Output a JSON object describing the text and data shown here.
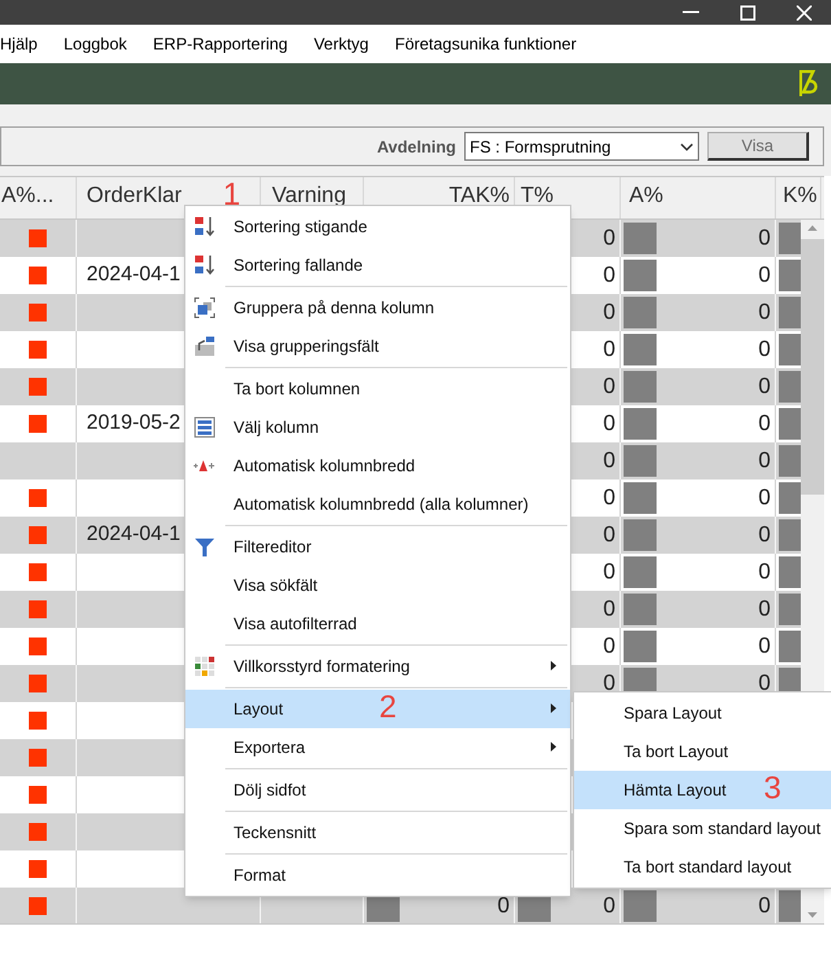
{
  "menu_bar": [
    "Hjälp",
    "Loggbok",
    "ERP-Rapportering",
    "Verktyg",
    "Företagsunika funktioner"
  ],
  "toolbar": {
    "label": "Avdelning",
    "department": {
      "value": "FS : Formsprutning"
    },
    "button": "Visa"
  },
  "grid": {
    "columns": [
      {
        "label": "A%..."
      },
      {
        "label": "OrderKlar",
        "annotation": "1"
      },
      {
        "label": "Varning"
      },
      {
        "label": "TAK%"
      },
      {
        "label": "T%"
      },
      {
        "label": "A%"
      },
      {
        "label": "K%"
      }
    ],
    "rows": [
      {
        "flag": true,
        "cells": [
          "",
          "",
          "",
          "",
          "0",
          "0",
          ""
        ],
        "bars": [
          false,
          false,
          true,
          true
        ]
      },
      {
        "flag": true,
        "cells": [
          "",
          "2024-04-1",
          "",
          "",
          "0",
          "0",
          ""
        ],
        "bars": [
          false,
          false,
          true,
          true
        ]
      },
      {
        "flag": true,
        "cells": [
          "",
          "",
          "",
          "",
          "0",
          "0",
          ""
        ],
        "bars": [
          false,
          false,
          true,
          true
        ]
      },
      {
        "flag": true,
        "cells": [
          "",
          "",
          "",
          "",
          "0",
          "0",
          ""
        ],
        "bars": [
          false,
          false,
          true,
          true
        ]
      },
      {
        "flag": true,
        "cells": [
          "",
          "",
          "",
          "",
          "0",
          "0",
          ""
        ],
        "bars": [
          false,
          false,
          true,
          true
        ]
      },
      {
        "flag": true,
        "cells": [
          "",
          "2019-05-2",
          "",
          "",
          "0",
          "0",
          ""
        ],
        "bars": [
          false,
          false,
          true,
          true
        ]
      },
      {
        "flag": false,
        "cells": [
          "",
          "",
          "",
          "",
          "0",
          "0",
          ""
        ],
        "bars": [
          false,
          false,
          true,
          true
        ]
      },
      {
        "flag": true,
        "cells": [
          "",
          "",
          "",
          "",
          "0",
          "0",
          ""
        ],
        "bars": [
          false,
          false,
          true,
          true
        ]
      },
      {
        "flag": true,
        "cells": [
          "",
          "2024-04-1",
          "",
          "",
          "0",
          "0",
          ""
        ],
        "bars": [
          false,
          false,
          true,
          true
        ]
      },
      {
        "flag": true,
        "cells": [
          "",
          "",
          "",
          "",
          "0",
          "0",
          ""
        ],
        "bars": [
          false,
          false,
          true,
          true
        ]
      },
      {
        "flag": true,
        "cells": [
          "",
          "",
          "",
          "",
          "0",
          "0",
          ""
        ],
        "bars": [
          false,
          false,
          true,
          true
        ]
      },
      {
        "flag": true,
        "cells": [
          "",
          "",
          "",
          "",
          "0",
          "0",
          ""
        ],
        "bars": [
          false,
          false,
          true,
          true
        ]
      },
      {
        "flag": true,
        "cells": [
          "",
          "",
          "",
          "",
          "0",
          "0",
          ""
        ],
        "bars": [
          false,
          false,
          true,
          true
        ]
      },
      {
        "flag": true,
        "cells": [
          "",
          "",
          "",
          "",
          "",
          "",
          ""
        ],
        "bars": [
          false,
          false,
          false,
          false
        ]
      },
      {
        "flag": true,
        "cells": [
          "",
          "",
          "",
          "",
          "",
          "",
          ""
        ],
        "bars": [
          false,
          false,
          false,
          false
        ]
      },
      {
        "flag": true,
        "cells": [
          "",
          "",
          "",
          "",
          "",
          "",
          ""
        ],
        "bars": [
          false,
          false,
          false,
          false
        ]
      },
      {
        "flag": true,
        "cells": [
          "",
          "",
          "",
          "",
          "",
          "",
          ""
        ],
        "bars": [
          false,
          false,
          false,
          false
        ]
      },
      {
        "flag": true,
        "cells": [
          "",
          "",
          "",
          "",
          "",
          "",
          ""
        ],
        "bars": [
          false,
          false,
          false,
          false
        ]
      },
      {
        "flag": true,
        "cells": [
          "",
          "",
          "",
          "0",
          "0",
          "0",
          ""
        ],
        "bars": [
          true,
          true,
          true,
          true
        ]
      }
    ]
  },
  "context_menu": {
    "items": [
      {
        "label": "Sortering stigande",
        "selected": false,
        "submenu": false
      },
      {
        "label": "Sortering fallande",
        "selected": false,
        "submenu": false
      },
      {
        "label": "Gruppera på denna kolumn",
        "selected": false,
        "submenu": false,
        "separator_before": true
      },
      {
        "label": "Visa grupperingsfält",
        "selected": false,
        "submenu": false
      },
      {
        "label": "Ta bort kolumnen",
        "selected": false,
        "submenu": false,
        "separator_before": true
      },
      {
        "label": "Välj kolumn",
        "selected": false,
        "submenu": false
      },
      {
        "label": "Automatisk kolumnbredd",
        "selected": false,
        "submenu": false
      },
      {
        "label": "Automatisk kolumnbredd (alla kolumner)",
        "selected": false,
        "submenu": false
      },
      {
        "label": "Filtereditor",
        "selected": false,
        "submenu": false,
        "separator_before": true
      },
      {
        "label": "Visa sökfält",
        "selected": false,
        "submenu": false
      },
      {
        "label": "Visa autofilterrad",
        "selected": false,
        "submenu": false
      },
      {
        "label": "Villkorsstyrd formatering",
        "selected": false,
        "submenu": true,
        "separator_before": true
      },
      {
        "label": "Layout",
        "selected": true,
        "submenu": true,
        "annotation": "2",
        "separator_before": true
      },
      {
        "label": "Exportera",
        "selected": false,
        "submenu": true
      },
      {
        "label": "Dölj sidfot",
        "selected": false,
        "submenu": false,
        "separator_before": true
      },
      {
        "label": "Teckensnitt",
        "selected": false,
        "submenu": false,
        "separator_before": true
      },
      {
        "label": "Format",
        "selected": false,
        "submenu": false,
        "separator_before": true
      }
    ]
  },
  "submenu": {
    "items": [
      {
        "label": "Spara Layout",
        "selected": false
      },
      {
        "label": "Ta bort Layout",
        "selected": false
      },
      {
        "label": "Hämta Layout",
        "selected": true,
        "annotation": "3"
      },
      {
        "label": "Spara som standard layout",
        "selected": false
      },
      {
        "label": "Ta bort standard layout",
        "selected": false
      }
    ]
  }
}
